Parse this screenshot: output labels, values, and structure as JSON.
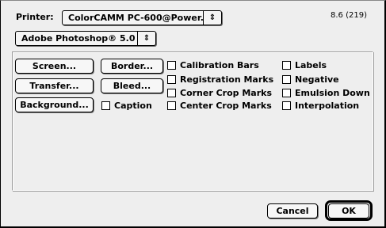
{
  "printer": {
    "label": "Printer:",
    "value": "ColorCAMM PC-600@Power...",
    "arrow": "⇕"
  },
  "version": "8.6 (219)",
  "app_popup": {
    "value": "Adobe Photoshop® 5.0",
    "arrow": "⇕"
  },
  "buttons": {
    "screen": "Screen...",
    "border": "Border...",
    "transfer": "Transfer...",
    "bleed": "Bleed...",
    "background": "Background..."
  },
  "checkboxes": {
    "caption": "Caption",
    "calibration_bars": "Calibration Bars",
    "registration_marks": "Registration Marks",
    "corner_crop_marks": "Corner Crop Marks",
    "center_crop_marks": "Center Crop Marks",
    "labels": "Labels",
    "negative": "Negative",
    "emulsion_down": "Emulsion Down",
    "interpolation": "Interpolation"
  },
  "footer": {
    "cancel": "Cancel",
    "ok": "OK"
  }
}
